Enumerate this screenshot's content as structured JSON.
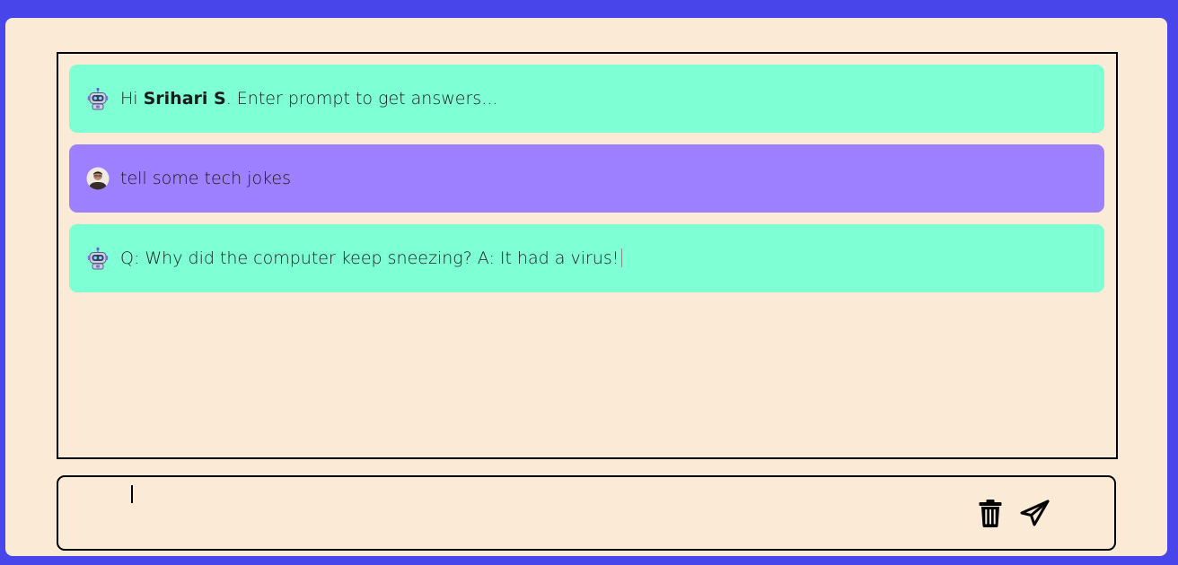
{
  "chat": {
    "messages": [
      {
        "role": "bot",
        "icon": "robot-icon",
        "prefix": "Hi ",
        "name": "Srihari S",
        "suffix": ". Enter prompt to get answers..."
      },
      {
        "role": "user",
        "icon": "user-avatar",
        "text": "tell some tech jokes"
      },
      {
        "role": "bot",
        "icon": "robot-icon",
        "text": "Q: Why did the computer keep sneezing? A: It had a virus!"
      }
    ]
  },
  "input": {
    "value": "",
    "placeholder": ""
  },
  "actions": {
    "clear_icon": "trash-icon",
    "send_icon": "send-icon"
  },
  "colors": {
    "background": "#4845ea",
    "panel": "#faead6",
    "bot_bubble": "#7fffd4",
    "user_bubble": "#9d80ff"
  }
}
